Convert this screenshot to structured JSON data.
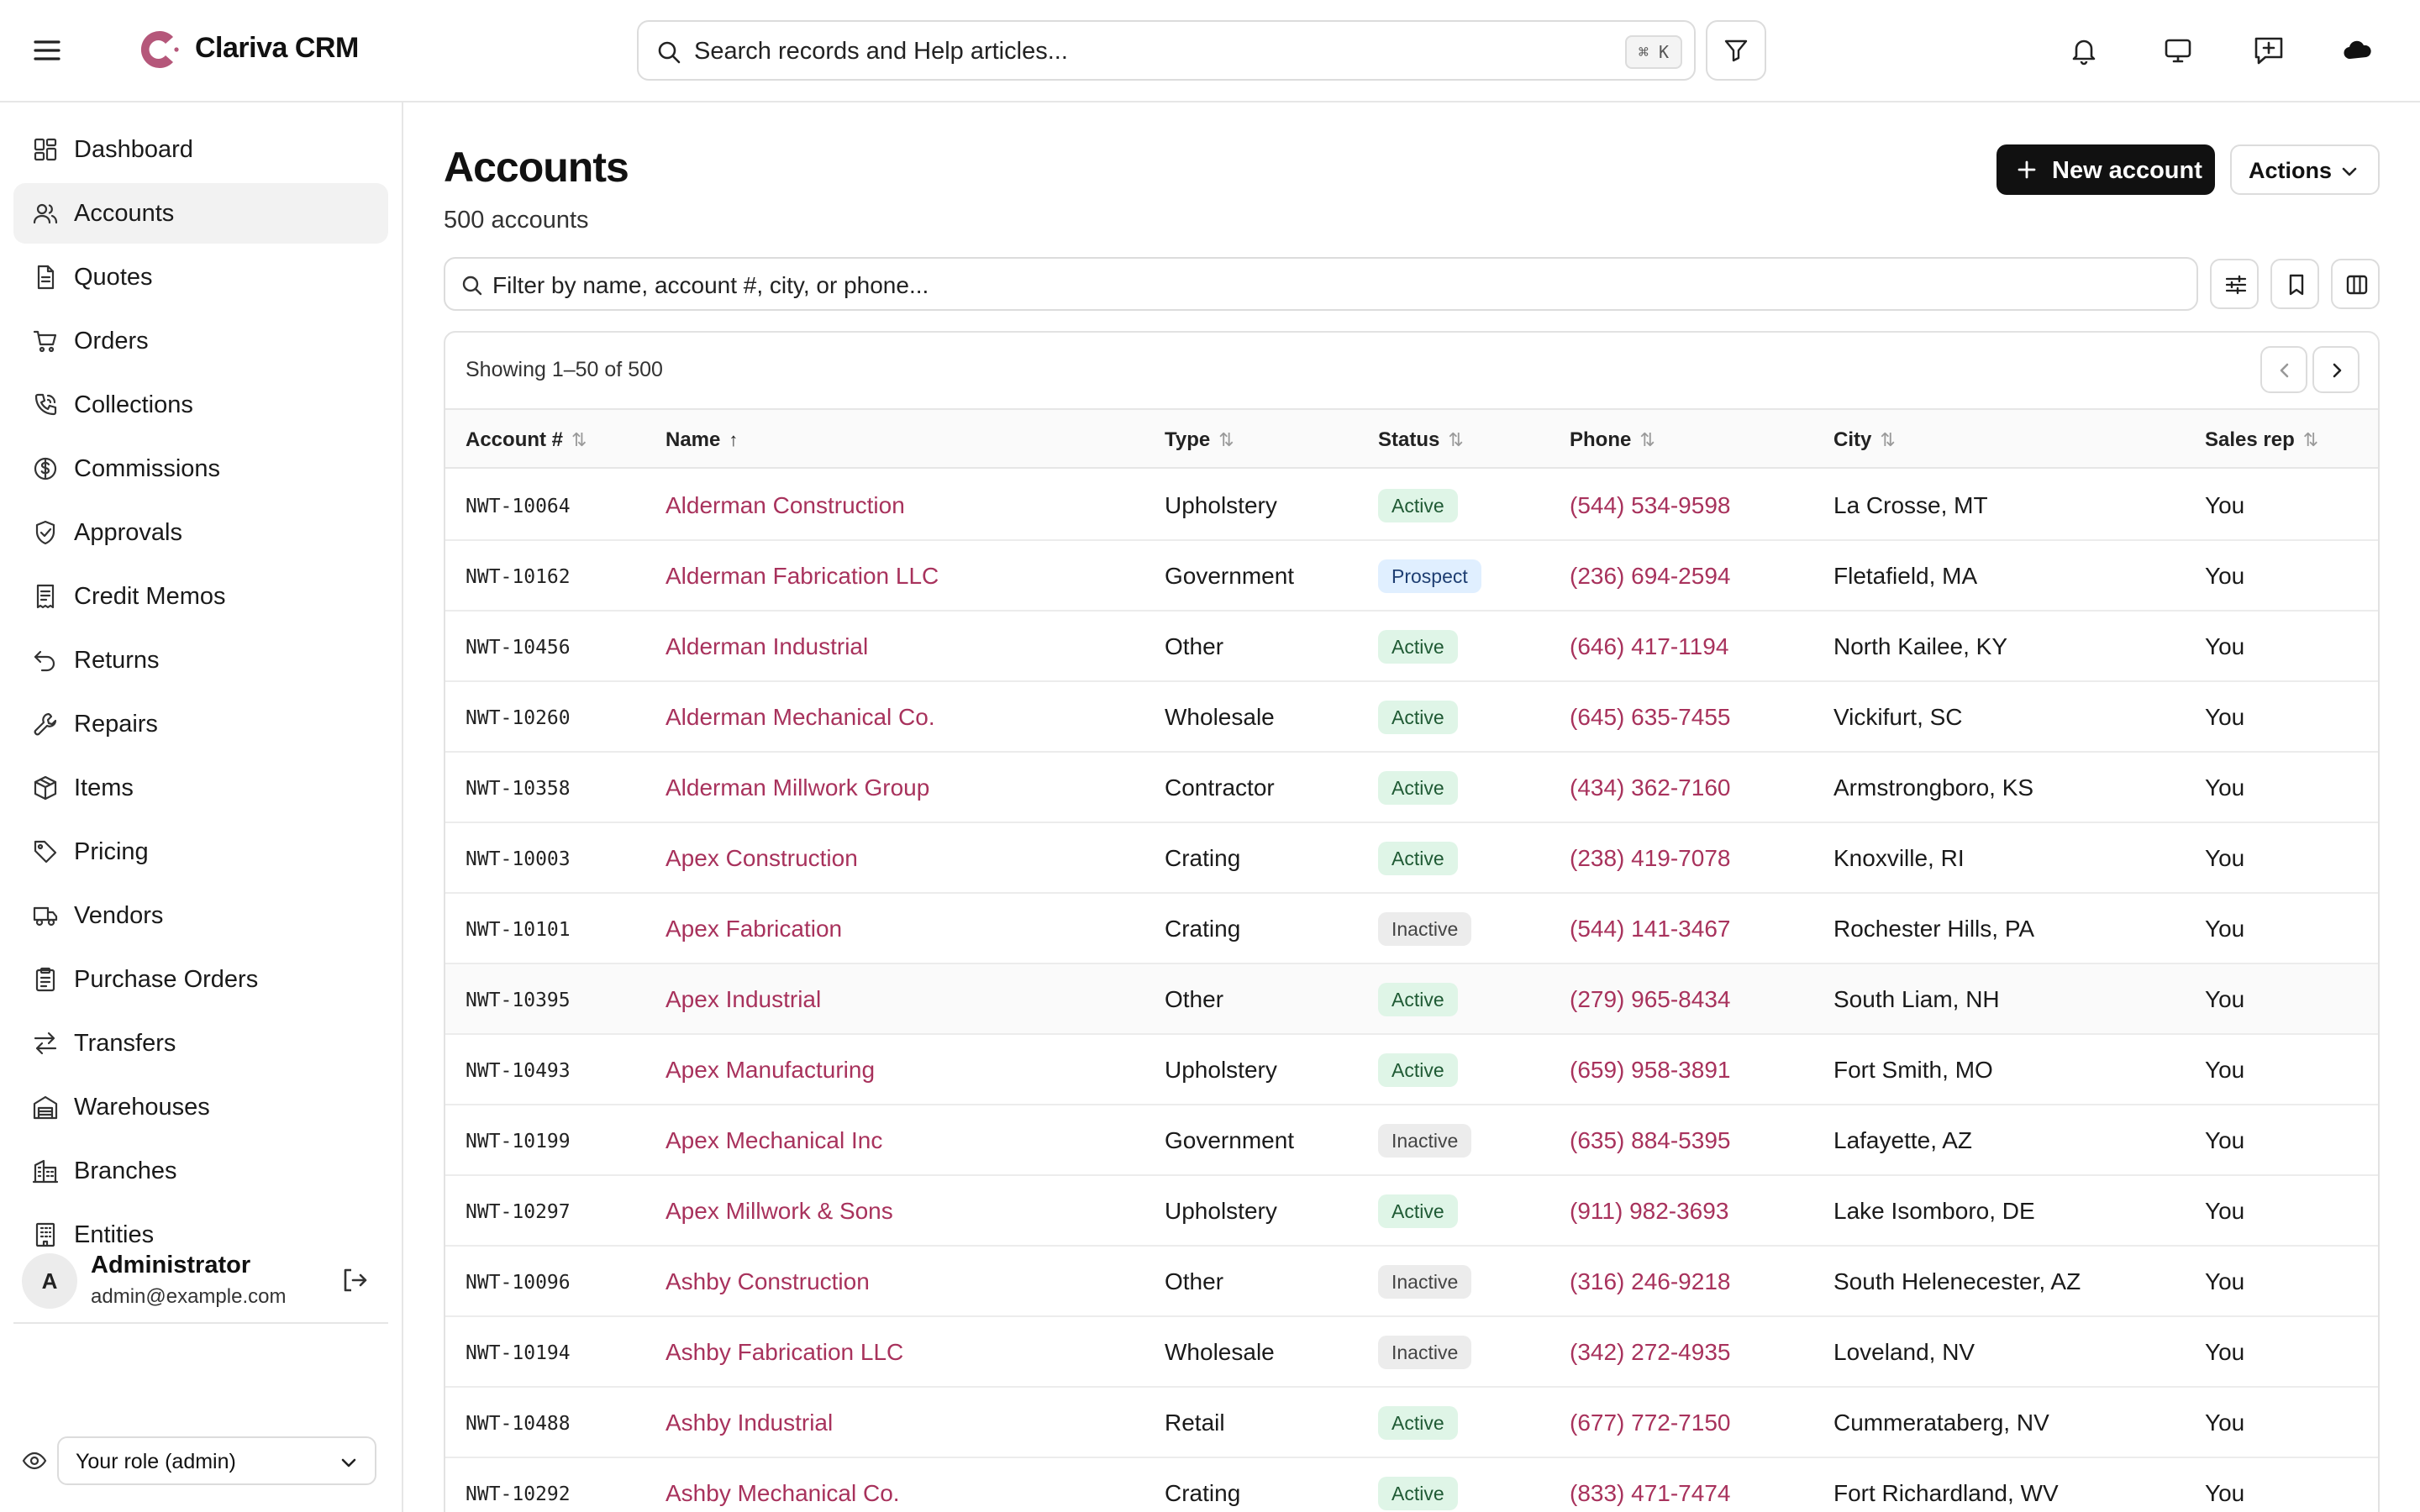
{
  "app": {
    "brand": "Clariva CRM",
    "accent_color": "#a8325c",
    "logo_color": "#b5577a"
  },
  "header": {
    "search_placeholder": "Search records and Help articles...",
    "shortcut": "⌘ K",
    "icons": [
      "menu-icon",
      "filter-icon",
      "bell-icon",
      "monitor-icon",
      "message-plus-icon",
      "cloud-icon"
    ]
  },
  "sidebar": {
    "items": [
      {
        "label": "Dashboard",
        "icon": "dashboard-icon",
        "active": false
      },
      {
        "label": "Accounts",
        "icon": "users-icon",
        "active": true
      },
      {
        "label": "Quotes",
        "icon": "document-icon",
        "active": false
      },
      {
        "label": "Orders",
        "icon": "cart-icon",
        "active": false
      },
      {
        "label": "Collections",
        "icon": "phone-icon",
        "active": false
      },
      {
        "label": "Commissions",
        "icon": "dollar-circle-icon",
        "active": false
      },
      {
        "label": "Approvals",
        "icon": "shield-check-icon",
        "active": false
      },
      {
        "label": "Credit Memos",
        "icon": "receipt-icon",
        "active": false
      },
      {
        "label": "Returns",
        "icon": "undo-icon",
        "active": false
      },
      {
        "label": "Repairs",
        "icon": "wrench-icon",
        "active": false
      },
      {
        "label": "Items",
        "icon": "box-icon",
        "active": false
      },
      {
        "label": "Pricing",
        "icon": "tag-icon",
        "active": false
      },
      {
        "label": "Vendors",
        "icon": "truck-icon",
        "active": false
      },
      {
        "label": "Purchase Orders",
        "icon": "clipboard-icon",
        "active": false
      },
      {
        "label": "Transfers",
        "icon": "arrows-swap-icon",
        "active": false
      },
      {
        "label": "Warehouses",
        "icon": "warehouse-icon",
        "active": false
      },
      {
        "label": "Branches",
        "icon": "building-icon",
        "active": false
      },
      {
        "label": "Entities",
        "icon": "office-icon",
        "active": false
      }
    ],
    "user": {
      "initial": "A",
      "name": "Administrator",
      "email": "admin@example.com"
    },
    "role_select": "Your role (admin)"
  },
  "main": {
    "title": "Accounts",
    "count": "500 accounts",
    "new_button": "New account",
    "actions_button": "Actions",
    "filter_placeholder": "Filter by name, account #, city, or phone...",
    "showing": "Showing 1–50 of 500",
    "columns": [
      "Account #",
      "Name",
      "Type",
      "Status",
      "Phone",
      "City",
      "Sales rep"
    ],
    "sort_column": "Name",
    "rows": [
      {
        "account": "NWT-10064",
        "name": "Alderman Construction",
        "type": "Upholstery",
        "status": "Active",
        "phone": "(544) 534-9598",
        "city": "La Crosse, MT",
        "rep": "You"
      },
      {
        "account": "NWT-10162",
        "name": "Alderman Fabrication LLC",
        "type": "Government",
        "status": "Prospect",
        "phone": "(236) 694-2594",
        "city": "Fletafield, MA",
        "rep": "You"
      },
      {
        "account": "NWT-10456",
        "name": "Alderman Industrial",
        "type": "Other",
        "status": "Active",
        "phone": "(646) 417-1194",
        "city": "North Kailee, KY",
        "rep": "You"
      },
      {
        "account": "NWT-10260",
        "name": "Alderman Mechanical Co.",
        "type": "Wholesale",
        "status": "Active",
        "phone": "(645) 635-7455",
        "city": "Vickifurt, SC",
        "rep": "You"
      },
      {
        "account": "NWT-10358",
        "name": "Alderman Millwork Group",
        "type": "Contractor",
        "status": "Active",
        "phone": "(434) 362-7160",
        "city": "Armstrongboro, KS",
        "rep": "You"
      },
      {
        "account": "NWT-10003",
        "name": "Apex Construction",
        "type": "Crating",
        "status": "Active",
        "phone": "(238) 419-7078",
        "city": "Knoxville, RI",
        "rep": "You"
      },
      {
        "account": "NWT-10101",
        "name": "Apex Fabrication",
        "type": "Crating",
        "status": "Inactive",
        "phone": "(544) 141-3467",
        "city": "Rochester Hills, PA",
        "rep": "You"
      },
      {
        "account": "NWT-10395",
        "name": "Apex Industrial",
        "type": "Other",
        "status": "Active",
        "phone": "(279) 965-8434",
        "city": "South Liam, NH",
        "rep": "You"
      },
      {
        "account": "NWT-10493",
        "name": "Apex Manufacturing",
        "type": "Upholstery",
        "status": "Active",
        "phone": "(659) 958-3891",
        "city": "Fort Smith, MO",
        "rep": "You"
      },
      {
        "account": "NWT-10199",
        "name": "Apex Mechanical Inc",
        "type": "Government",
        "status": "Inactive",
        "phone": "(635) 884-5395",
        "city": "Lafayette, AZ",
        "rep": "You"
      },
      {
        "account": "NWT-10297",
        "name": "Apex Millwork & Sons",
        "type": "Upholstery",
        "status": "Active",
        "phone": "(911) 982-3693",
        "city": "Lake Isomboro, DE",
        "rep": "You"
      },
      {
        "account": "NWT-10096",
        "name": "Ashby Construction",
        "type": "Other",
        "status": "Inactive",
        "phone": "(316) 246-9218",
        "city": "South Helenecester, AZ",
        "rep": "You"
      },
      {
        "account": "NWT-10194",
        "name": "Ashby Fabrication LLC",
        "type": "Wholesale",
        "status": "Inactive",
        "phone": "(342) 272-4935",
        "city": "Loveland, NV",
        "rep": "You"
      },
      {
        "account": "NWT-10488",
        "name": "Ashby Industrial",
        "type": "Retail",
        "status": "Active",
        "phone": "(677) 772-7150",
        "city": "Cummerataberg, NV",
        "rep": "You"
      },
      {
        "account": "NWT-10292",
        "name": "Ashby Mechanical Co.",
        "type": "Crating",
        "status": "Active",
        "phone": "(833) 471-7474",
        "city": "Fort Richardland, WV",
        "rep": "You"
      }
    ]
  }
}
